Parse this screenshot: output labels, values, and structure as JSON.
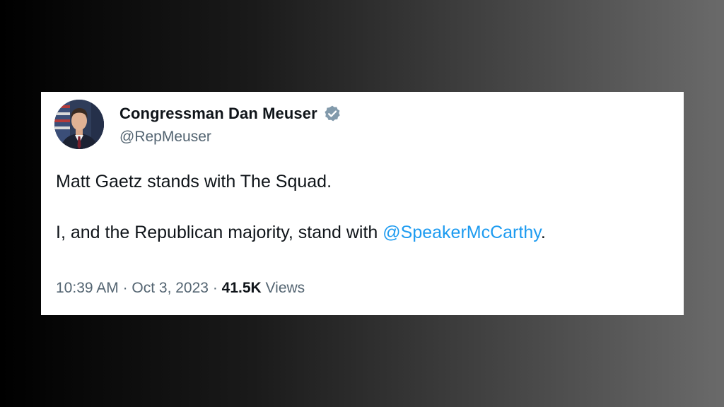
{
  "tweet": {
    "author": {
      "display_name": "Congressman Dan Meuser",
      "handle": "@RepMeuser"
    },
    "body": {
      "line1": "Matt Gaetz stands with The Squad.",
      "line2_prefix": "I, and the Republican majority, stand with ",
      "line2_mention": "@SpeakerMcCarthy",
      "line2_suffix": "."
    },
    "meta": {
      "time": "10:39 AM",
      "separator1": " · ",
      "date": "Oct 3, 2023",
      "separator2": " · ",
      "views_count": "41.5K",
      "views_label": " Views"
    }
  },
  "colors": {
    "mention": "#1d9bf0",
    "verified_badge": "#829aab",
    "secondary_text": "#536471",
    "primary_text": "#0f1419"
  },
  "icons": {
    "avatar": "avatar",
    "verified": "verified-badge-icon"
  }
}
